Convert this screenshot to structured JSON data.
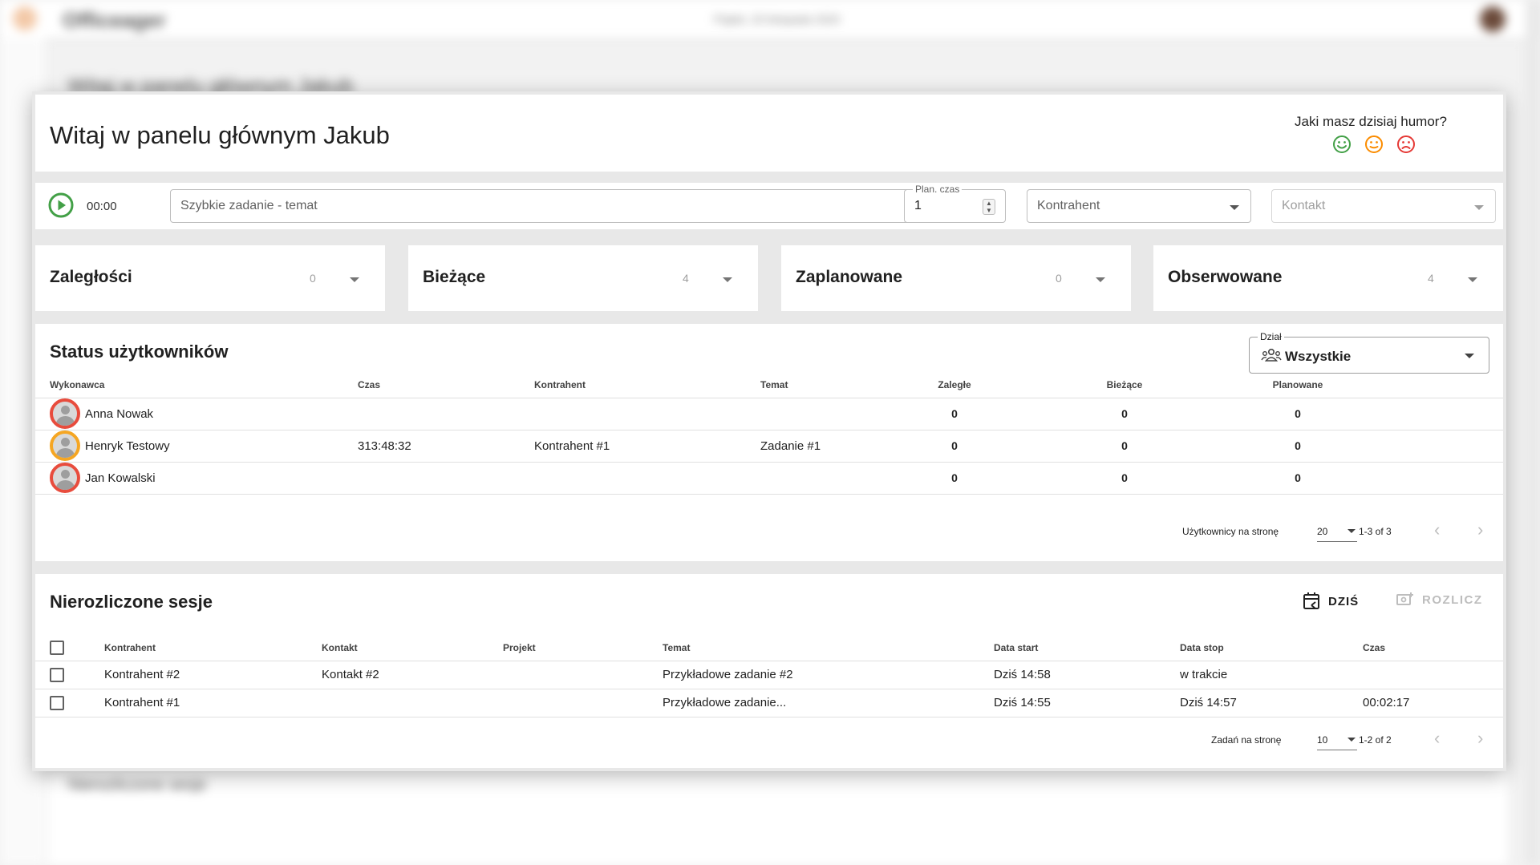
{
  "background": {
    "app_name": "Officeager",
    "date_text": "Piątek, 20 listopada 2020",
    "page_title": "Witaj w panelu głównym Jakub",
    "lower_section": "Nierozliczone sesje"
  },
  "welcome": {
    "title": "Witaj w panelu głównym Jakub",
    "mood_question": "Jaki masz dzisiaj humor?",
    "moods": [
      {
        "icon": "smile-happy-icon",
        "color": "#43a047"
      },
      {
        "icon": "smile-neutral-icon",
        "color": "#fb8c00"
      },
      {
        "icon": "smile-sad-icon",
        "color": "#e53935"
      }
    ]
  },
  "quick_task": {
    "timer": "00:00",
    "topic_placeholder": "Szybkie zadanie - temat",
    "plan_label": "Plan. czas",
    "plan_value": "1",
    "kontrahent_placeholder": "Kontrahent",
    "kontakt_placeholder": "Kontakt"
  },
  "stats": [
    {
      "name": "Zaległości",
      "count": "0"
    },
    {
      "name": "Bieżące",
      "count": "4"
    },
    {
      "name": "Zaplanowane",
      "count": "0"
    },
    {
      "name": "Obserwowane",
      "count": "4"
    }
  ],
  "users_status": {
    "title": "Status użytkowników",
    "dzial_label": "Dział",
    "dzial_value": "Wszystkie",
    "columns": [
      "Wykonawca",
      "Czas",
      "Kontrahent",
      "Temat",
      "Zaległe",
      "Bieżące",
      "Planowane"
    ],
    "rows": [
      {
        "name": "Anna Nowak",
        "status": "offline",
        "czas": "",
        "kontrahent": "",
        "temat": "",
        "zalegle": "0",
        "biezace": "0",
        "planowane": "0"
      },
      {
        "name": "Henryk Testowy",
        "status": "busy",
        "czas": "313:48:32",
        "kontrahent": "Kontrahent #1",
        "temat": "Zadanie #1",
        "zalegle": "0",
        "biezace": "0",
        "planowane": "0"
      },
      {
        "name": "Jan Kowalski",
        "status": "offline",
        "czas": "",
        "kontrahent": "",
        "temat": "",
        "zalegle": "0",
        "biezace": "0",
        "planowane": "0"
      }
    ],
    "per_page_label": "Użytkownicy na stronę",
    "per_page": "20",
    "range": "1-3 of 3"
  },
  "sessions": {
    "title": "Nierozliczone sesje",
    "today_label": "DZIŚ",
    "settle_label": "ROZLICZ",
    "columns": [
      "Kontrahent",
      "Kontakt",
      "Projekt",
      "Temat",
      "Data start",
      "Data stop",
      "Czas"
    ],
    "rows": [
      {
        "kontrahent": "Kontrahent #2",
        "kontakt": "Kontakt #2",
        "projekt": "",
        "temat": "Przykładowe zadanie #2",
        "start": "Dziś 14:58",
        "stop": "w trakcie",
        "czas": ""
      },
      {
        "kontrahent": "Kontrahent #1",
        "kontakt": "",
        "projekt": "",
        "temat": "Przykładowe zadanie...",
        "start": "Dziś 14:55",
        "stop": "Dziś 14:57",
        "czas": "00:02:17"
      }
    ],
    "per_page_label": "Zadań na stronę",
    "per_page": "10",
    "range": "1-2 of 2"
  },
  "colors": {
    "accent_green": "#43a047",
    "status_offline": "#e84c3d",
    "status_busy": "#f5a623"
  }
}
